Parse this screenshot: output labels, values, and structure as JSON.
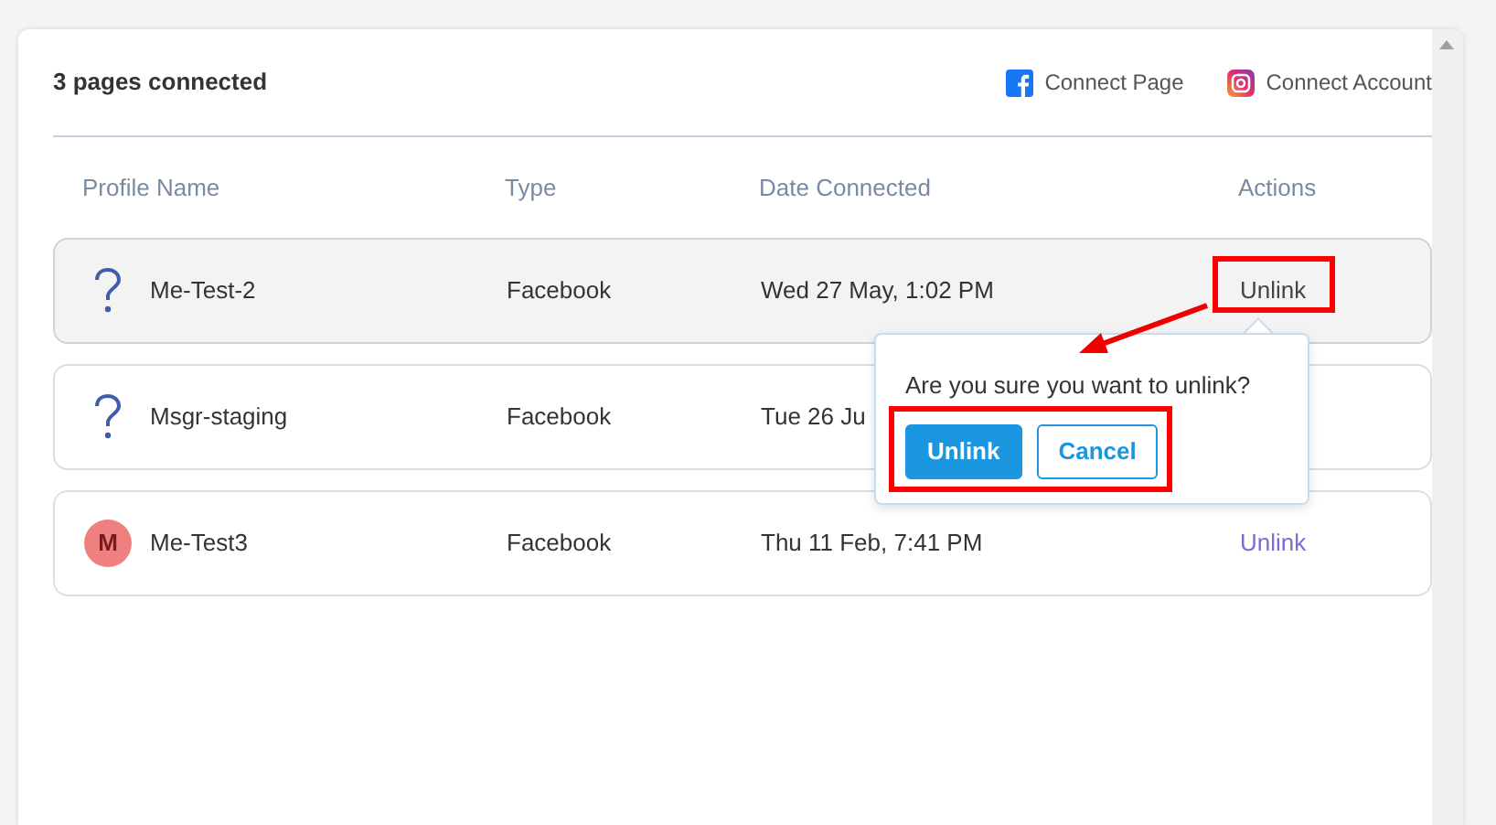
{
  "header": {
    "title": "3 pages connected",
    "actions": [
      {
        "kind": "facebook",
        "label": "Connect Page"
      },
      {
        "kind": "instagram",
        "label": "Connect Account"
      }
    ]
  },
  "table": {
    "columns": [
      "Profile Name",
      "Type",
      "Date Connected",
      "Actions"
    ],
    "rows": [
      {
        "avatar": {
          "kind": "unknown"
        },
        "name": "Me-Test-2",
        "type": "Facebook",
        "date": "Wed 27 May, 1:02 PM",
        "action": "Unlink",
        "active": true
      },
      {
        "avatar": {
          "kind": "unknown"
        },
        "name": "Msgr-staging",
        "type": "Facebook",
        "date": "Tue 26 Ju",
        "active": false
      },
      {
        "avatar": {
          "kind": "letter",
          "text": "M"
        },
        "name": "Me-Test3",
        "type": "Facebook",
        "date": "Thu 11 Feb, 7:41 PM",
        "action": "Unlink",
        "active": false
      }
    ]
  },
  "popover": {
    "message": "Are you sure you want to unlink?",
    "buttons": [
      {
        "kind": "primary",
        "label": "Unlink"
      },
      {
        "kind": "outline",
        "label": "Cancel"
      }
    ]
  }
}
